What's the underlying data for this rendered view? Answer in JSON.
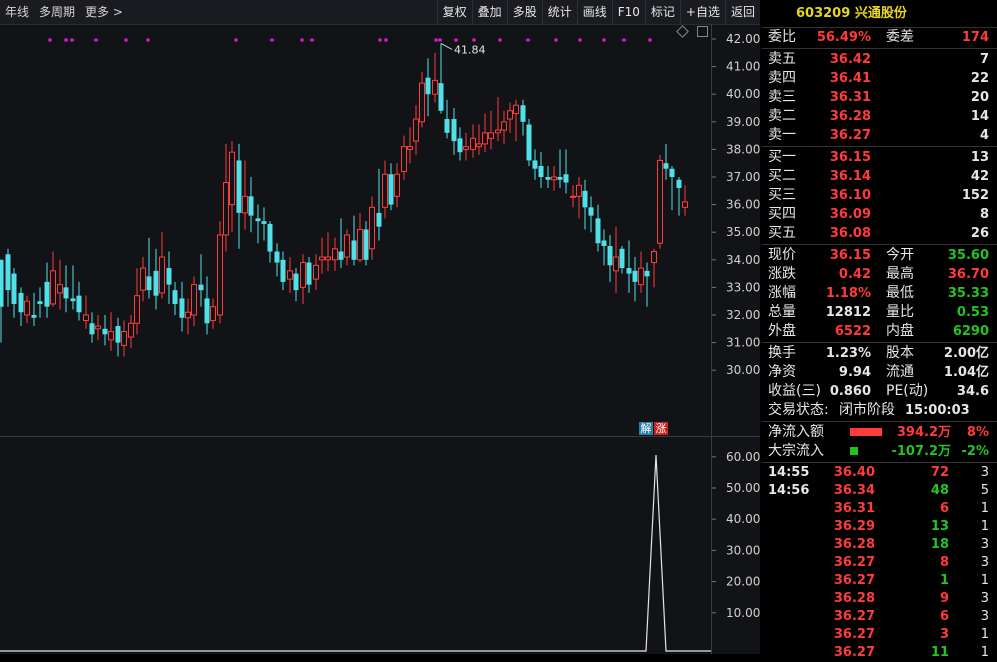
{
  "toolbar": {
    "left_items": [
      "年线",
      "多周期",
      "更多 >"
    ],
    "right_items": [
      "复权",
      "叠加",
      "多股",
      "统计",
      "画线",
      "F10",
      "标记",
      "+自选",
      "返回"
    ]
  },
  "kline": {
    "y_ticks": [
      "42.00",
      "41.00",
      "40.00",
      "39.00",
      "38.00",
      "37.00",
      "36.00",
      "35.00",
      "34.00",
      "33.00",
      "32.00",
      "31.00",
      "30.00"
    ],
    "high_label": "41.84",
    "badges": [
      "解",
      "涨"
    ],
    "colors": {
      "up": "#ff3b3b",
      "down": "#4fe0e8",
      "markers": "#d11ed1"
    }
  },
  "volume": {
    "y_ticks": [
      "60.00",
      "50.00",
      "40.00",
      "30.00",
      "20.00",
      "10.00"
    ]
  },
  "stock": {
    "code": "603209",
    "name": "兴通股份"
  },
  "book": {
    "weibi_label": "委比",
    "weibi_value": "56.49%",
    "weicha_label": "委差",
    "weicha_value": "174",
    "asks": [
      {
        "label": "卖五",
        "price": "36.42",
        "vol": "7"
      },
      {
        "label": "卖四",
        "price": "36.41",
        "vol": "22"
      },
      {
        "label": "卖三",
        "price": "36.31",
        "vol": "20"
      },
      {
        "label": "卖二",
        "price": "36.28",
        "vol": "14"
      },
      {
        "label": "卖一",
        "price": "36.27",
        "vol": "4"
      }
    ],
    "bids": [
      {
        "label": "买一",
        "price": "36.15",
        "vol": "13"
      },
      {
        "label": "买二",
        "price": "36.14",
        "vol": "42"
      },
      {
        "label": "买三",
        "price": "36.10",
        "vol": "152"
      },
      {
        "label": "买四",
        "price": "36.09",
        "vol": "8"
      },
      {
        "label": "买五",
        "price": "36.08",
        "vol": "26"
      }
    ]
  },
  "quote": [
    {
      "l1": "现价",
      "v1": "36.15",
      "c1": "red",
      "l2": "今开",
      "v2": "35.60",
      "c2": "green"
    },
    {
      "l1": "涨跌",
      "v1": "0.42",
      "c1": "red",
      "l2": "最高",
      "v2": "36.70",
      "c2": "red"
    },
    {
      "l1": "涨幅",
      "v1": "1.18%",
      "c1": "red",
      "l2": "最低",
      "v2": "35.33",
      "c2": "green"
    },
    {
      "l1": "总量",
      "v1": "12812",
      "c1": "white",
      "l2": "量比",
      "v2": "0.53",
      "c2": "green"
    },
    {
      "l1": "外盘",
      "v1": "6522",
      "c1": "red",
      "l2": "内盘",
      "v2": "6290",
      "c2": "green"
    }
  ],
  "fundamentals": [
    {
      "l1": "换手",
      "v1": "1.23%",
      "l2": "股本",
      "v2": "2.00亿"
    },
    {
      "l1": "净资",
      "v1": "9.94",
      "l2": "流通",
      "v2": "1.04亿"
    },
    {
      "l1": "收益(三)",
      "v1": "0.860",
      "l2": "PE(动)",
      "v2": "34.6"
    }
  ],
  "status": {
    "label": "交易状态:",
    "phase": "闭市阶段",
    "time": "15:00:03"
  },
  "flows": [
    {
      "label": "净流入额",
      "value": "394.2万",
      "pct": "8%",
      "color": "red",
      "bar": 0.8
    },
    {
      "label": "大宗流入",
      "value": "-107.2万",
      "pct": "-2%",
      "color": "green",
      "bar": 0.2
    }
  ],
  "ticks": [
    {
      "time": "14:55",
      "price": "36.40",
      "vol": "72",
      "vc": "red",
      "n": "3"
    },
    {
      "time": "14:56",
      "price": "36.34",
      "vol": "48",
      "vc": "green",
      "n": "5"
    },
    {
      "time": "",
      "price": "36.31",
      "vol": "6",
      "vc": "red",
      "n": "1"
    },
    {
      "time": "",
      "price": "36.29",
      "vol": "13",
      "vc": "green",
      "n": "1"
    },
    {
      "time": "",
      "price": "36.28",
      "vol": "18",
      "vc": "green",
      "n": "3"
    },
    {
      "time": "",
      "price": "36.27",
      "vol": "8",
      "vc": "red",
      "n": "3"
    },
    {
      "time": "",
      "price": "36.27",
      "vol": "1",
      "vc": "green",
      "n": "1"
    },
    {
      "time": "",
      "price": "36.28",
      "vol": "9",
      "vc": "red",
      "n": "3"
    },
    {
      "time": "",
      "price": "36.27",
      "vol": "6",
      "vc": "red",
      "n": "3"
    },
    {
      "time": "",
      "price": "36.27",
      "vol": "3",
      "vc": "red",
      "n": "1"
    },
    {
      "time": "",
      "price": "36.27",
      "vol": "11",
      "vc": "green",
      "n": "1"
    }
  ]
}
